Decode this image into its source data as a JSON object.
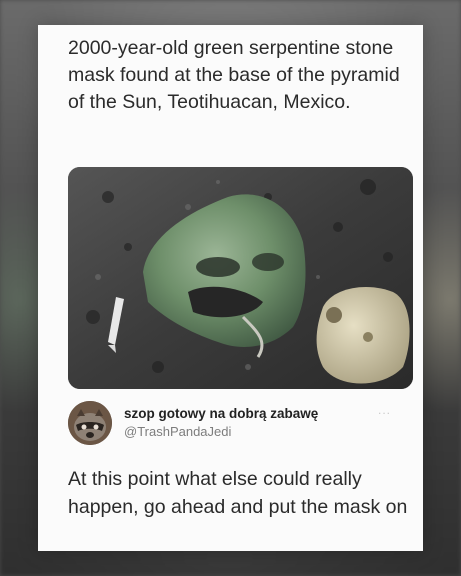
{
  "post": {
    "caption": "2000-year-old green serpentine stone mask found at the base of the pyramid of the Sun, Teotihuacan, Mexico."
  },
  "reply": {
    "author_name": "szop gotowy na dobrą zabawę",
    "author_handle": "@TrashPandaJedi",
    "more_icon": "...",
    "text": "At this point what else could really happen, go ahead and put the mask on"
  },
  "icons": {
    "more": "more-options-icon",
    "avatar": "avatar-raccoon"
  },
  "colors": {
    "card_background": "#fbfbfb",
    "text_primary": "#2b2b2b",
    "handle_gray": "#7d7d7d",
    "mask_green": "#6e8f6a"
  }
}
